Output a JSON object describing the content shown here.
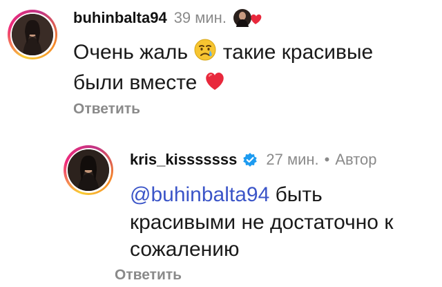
{
  "comments": [
    {
      "username": "buhinbalta94",
      "time": "39 мин.",
      "text_before_emoji": "Очень жаль",
      "emoji_1": "crying-face",
      "text_after_emoji": "такие красивые",
      "text_line2": "были вместе",
      "emoji_2": "red-heart",
      "reply_label": "Ответить",
      "liked_by_author_icon": "avatar-with-heart"
    },
    {
      "username": "kris_kisssssss",
      "verified": true,
      "time": "27 мин.",
      "separator": "•",
      "author_label": "Автор",
      "mention": "@buhinbalta94",
      "text_rest": "быть",
      "text_line2": "красивыми не достаточно к",
      "text_line3": "сожалению",
      "reply_label": "Ответить"
    }
  ],
  "colors": {
    "mention": "#3b55c8",
    "meta_gray": "#8a8a8a",
    "verified_blue": "#1d9bf0",
    "heart_red": "#e8283c"
  }
}
